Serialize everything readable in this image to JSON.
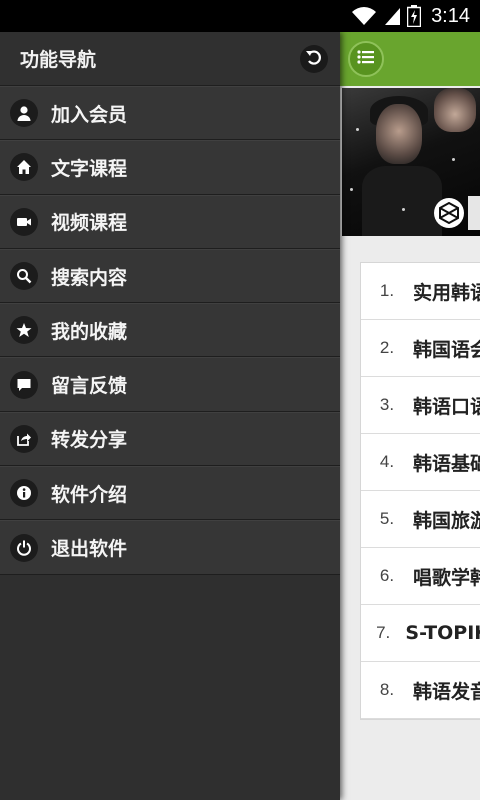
{
  "status_bar": {
    "time": "3:14",
    "battery_level": "charging",
    "icons": [
      "wifi-icon",
      "signal-icon",
      "battery-icon"
    ]
  },
  "drawer": {
    "title": "功能导航",
    "back_icon": "undo-icon",
    "items": [
      {
        "label": "加入会员",
        "icon": "user-icon"
      },
      {
        "label": "文字课程",
        "icon": "home-icon"
      },
      {
        "label": "视频课程",
        "icon": "video-icon"
      },
      {
        "label": "搜索内容",
        "icon": "search-icon"
      },
      {
        "label": "我的收藏",
        "icon": "star-icon"
      },
      {
        "label": "留言反馈",
        "icon": "comment-icon"
      },
      {
        "label": "转发分享",
        "icon": "share-icon"
      },
      {
        "label": "软件介绍",
        "icon": "info-icon"
      },
      {
        "label": "退出软件",
        "icon": "power-icon"
      }
    ]
  },
  "content": {
    "menu_toggle_icon": "list-icon",
    "list": [
      {
        "num": "1.",
        "title": "实用韩语"
      },
      {
        "num": "2.",
        "title": "韩国语会"
      },
      {
        "num": "3.",
        "title": "韩语口语"
      },
      {
        "num": "4.",
        "title": "韩语基础"
      },
      {
        "num": "5.",
        "title": "韩国旅游"
      },
      {
        "num": "6.",
        "title": "唱歌学韩"
      },
      {
        "num": "7.",
        "title": "S-TOPIK"
      },
      {
        "num": "8.",
        "title": "韩语发音"
      }
    ]
  },
  "colors": {
    "accent_green": "#69a52e",
    "drawer_bg": "#363636",
    "status_bar_bg": "#000000"
  }
}
